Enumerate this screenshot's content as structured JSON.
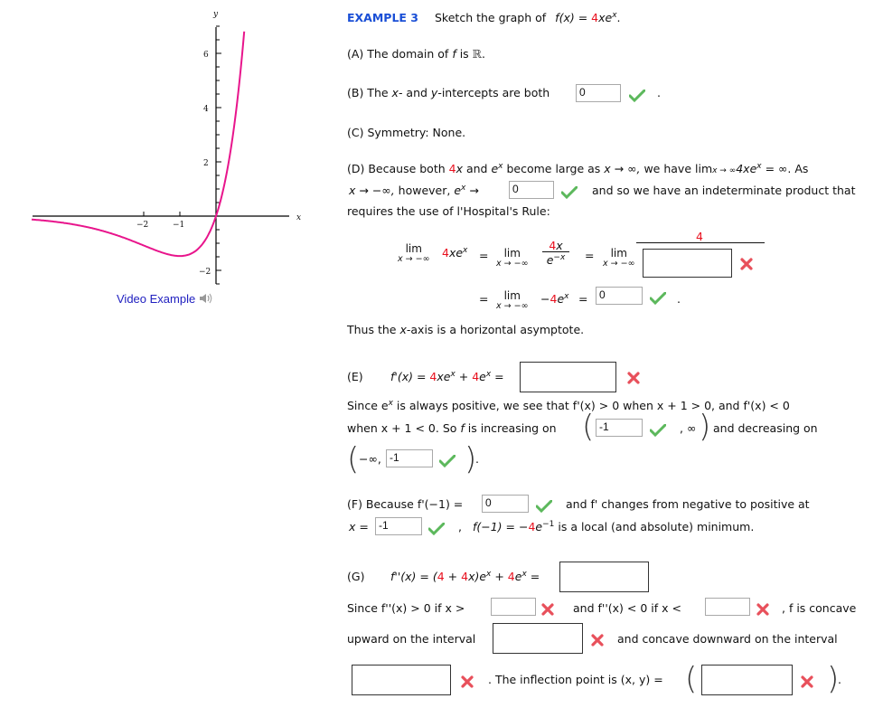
{
  "graph": {
    "function_label": "f(x) = 4xe^x",
    "curve_color": "#e8158c",
    "x_axis_label": "x",
    "y_axis_label": "y",
    "x_ticks": [
      {
        "value": -2,
        "label": "−2"
      },
      {
        "value": -1,
        "label": "−1"
      }
    ],
    "y_ticks": [
      {
        "value": 6,
        "label": "6"
      },
      {
        "value": 4,
        "label": "4"
      },
      {
        "value": 2,
        "label": "2"
      },
      {
        "value": -2,
        "label": "−2"
      }
    ],
    "x_range": [
      -5,
      2
    ],
    "y_range": [
      -2.5,
      7
    ],
    "video_example_label": "Video Example"
  },
  "header": {
    "example_label": "EXAMPLE 3",
    "prompt": "Sketch the graph of",
    "fx": "f(x) = ",
    "fx_red": "4",
    "fx_rest": "xe",
    "fx_sup": "x",
    "period": "."
  },
  "partA": {
    "text1": "(A) The domain of ",
    "f": "f",
    "text2": " is ",
    "R": "ℝ",
    "end": "."
  },
  "partB": {
    "text1": "(B) The ",
    "x": "x",
    "mid1": "- and ",
    "y": "y",
    "mid2": "-intercepts are both",
    "answer": "0",
    "end": "."
  },
  "partC": {
    "text": "(C) Symmetry: None."
  },
  "partD": {
    "line1a": "(D) Because both ",
    "fourx_red": "4",
    "fourx_x": "x",
    "and": " and ",
    "e": "e",
    "ex_sup": "x",
    "line1b": " become large as ",
    "x_to_inf": "x → ∞,",
    "we_have": " we have ",
    "lim": "lim",
    "lim_sub": "x → ∞",
    "lim_expr": "4xe",
    "lim_result": " = ∞.  As",
    "line2a": "x → −∞,",
    "however": " however, ",
    "arrow": " →",
    "answer": "0",
    "line2b": "and so we have an indeterminate product that",
    "line3": "requires the use of l'Hospital's Rule:",
    "lim_label": "lim",
    "lim_under": "x → −∞",
    "expr1": "4xe",
    "eq": "=",
    "frac_num": "4x",
    "frac_den": "e",
    "frac_den_sup": "−x",
    "numerator_4": "4",
    "answer_denominator": "",
    "expr4": "−4e",
    "answer_limit": "0",
    "end": "."
  },
  "thus": {
    "text1": "Thus the ",
    "x": "x",
    "text2": "-axis is a horizontal asymptote."
  },
  "partE": {
    "label": "(E)",
    "fprime": "f'(x) = ",
    "term1": "4xe",
    "plus": " + ",
    "term2": "4e",
    "eq": " =",
    "answer": "",
    "line2": "Since  e",
    "line2b": " is always positive, we see that  f'(x) > 0  when  x + 1 > 0,  and  f'(x) < 0",
    "line3a": "when  x + 1 < 0.  So ",
    "line3f": "f",
    "line3b": " is increasing on",
    "inc_answer": "-1",
    "inc_tail": ", ∞",
    "dec_text": "and decreasing on",
    "dec_head": "−∞,",
    "dec_answer": "-1",
    "end": "."
  },
  "partF": {
    "text1": "(F) Because  f'(−1) =",
    "answer1": "0",
    "text2": "and  f'  changes from negative to positive at",
    "xeq": "x =",
    "answer2": "-1",
    "comma": ",",
    "fm1": "f(−1) = −",
    "fm1_red": "4",
    "fm1_e": "e",
    "fm1_sup": "−1",
    "text3": " is a local (and absolute) minimum."
  },
  "partG": {
    "label": "(G)",
    "f2": "f''(x) = (",
    "f2_4": "4",
    "plus": " + ",
    "f2_4x": "4",
    "f2_mid": "x)e",
    "plus2": " + ",
    "f2_4e": "4",
    "f2_e": "e",
    "eq": " =",
    "answer": "",
    "since": "Since  f''(x) > 0  if  x >",
    "answer_gt": "",
    "and": "and  f''(x) < 0  if  x <",
    "answer_lt": "",
    "concave": ",  f is concave",
    "upward": "upward on the interval",
    "answer_up": "",
    "down_text": "and concave downward on the interval",
    "answer_down": "",
    "inflection": ". The inflection point is  (x, y) =",
    "answer_inflection": "",
    "end": "."
  },
  "status_icons": {
    "correct": "check-icon",
    "incorrect": "cross-icon",
    "correct_color": "#5cb85c",
    "incorrect_color": "#e8505b"
  }
}
